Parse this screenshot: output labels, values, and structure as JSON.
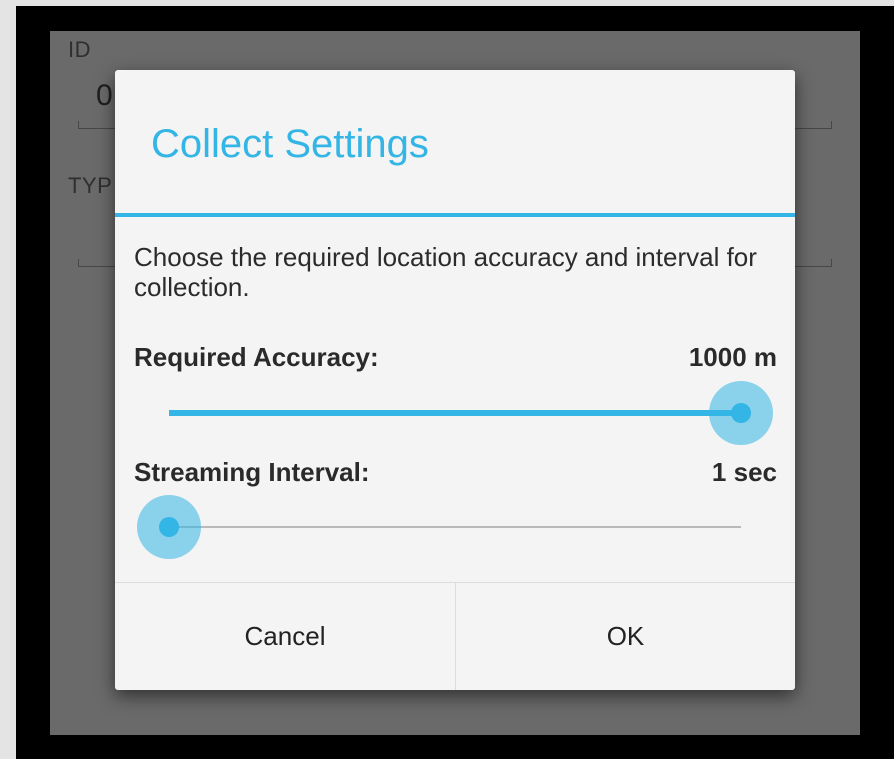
{
  "background_form": {
    "id_label": "ID",
    "id_value": "0",
    "type_label": "TYP"
  },
  "dialog": {
    "title": "Collect Settings",
    "message": "Choose the required location accuracy and interval for collection.",
    "accuracy": {
      "label": "Required Accuracy:",
      "value_text": "1000 m",
      "slider_fraction": 1.0
    },
    "interval": {
      "label": "Streaming Interval:",
      "value_text": "1 sec",
      "slider_fraction": 0.0
    },
    "buttons": {
      "cancel": "Cancel",
      "ok": "OK"
    }
  },
  "colors": {
    "accent": "#33b5e5",
    "scrim": "#6a6a6a",
    "dialog_bg": "#f4f4f4"
  }
}
